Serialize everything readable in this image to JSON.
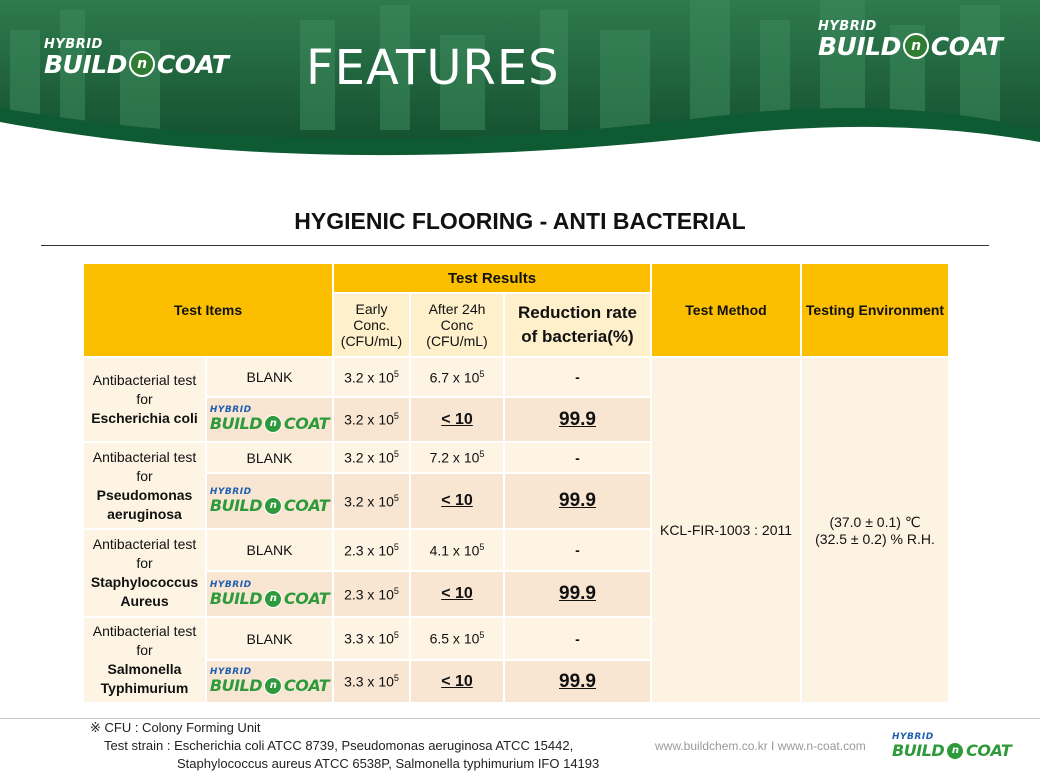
{
  "header": {
    "logo_hybrid": "HYBRID",
    "logo_build": "BUILD",
    "logo_n": "n",
    "logo_coat": "COAT",
    "title": "FEATURES"
  },
  "subtitle": "HYGIENIC FLOORING - ANTI BACTERIAL",
  "table": {
    "headers": {
      "test_items": "Test Items",
      "test_results": "Test Results",
      "early_conc": "Early Conc. (CFU/mL)",
      "after_24h": "After 24h Conc (CFU/mL)",
      "reduction": "Reduction rate of bacteria(%)",
      "test_method": "Test Method",
      "testing_env": "Testing Environment"
    },
    "test_method_value": "KCL-FIR-1003 : 2011",
    "env_line1": "(37.0 ± 0.1) ℃",
    "env_line2": "(32.5 ± 0.2) % R.H.",
    "groups": [
      {
        "prefix": "Antibacterial test for",
        "organism": "Escherichia coli",
        "blank_label": "BLANK",
        "blank_early": "3.2 x 10",
        "blank_after": "6.7 x 10",
        "blank_reduction": "-",
        "product_early": "3.2 x 10",
        "product_after": "< 10",
        "product_reduction": "99.9"
      },
      {
        "prefix": "Antibacterial test for",
        "organism": "Pseudomonas aeruginosa",
        "blank_label": "BLANK",
        "blank_early": "3.2 x 10",
        "blank_after": "7.2 x 10",
        "blank_reduction": "-",
        "product_early": "3.2 x 10",
        "product_after": "< 10",
        "product_reduction": "99.9"
      },
      {
        "prefix": "Antibacterial test for",
        "organism": "Staphylococcus Aureus",
        "blank_label": "BLANK",
        "blank_early": "2.3 x 10",
        "blank_after": "4.1 x 10",
        "blank_reduction": "-",
        "product_early": "2.3 x 10",
        "product_after": "< 10",
        "product_reduction": "99.9"
      },
      {
        "prefix": "Antibacterial test for",
        "organism": "Salmonella Typhimurium",
        "blank_label": "BLANK",
        "blank_early": "3.3 x 10",
        "blank_after": "6.5 x 10",
        "blank_reduction": "-",
        "product_early": "3.3 x 10",
        "product_after": "< 10",
        "product_reduction": "99.9"
      }
    ],
    "exponent": "5"
  },
  "footer": {
    "note1": "※ CFU : Colony Forming Unit",
    "note2": "Test strain : Escherichia coli ATCC 8739, Pseudomonas aeruginosa ATCC 15442,",
    "note3": "Staphylococcus aureus ATCC 6538P, Salmonella typhimurium IFO 14193",
    "url": "www.buildchem.co.kr I www.n-coat.com"
  },
  "colors": {
    "header_green": "#1d6b3c",
    "table_header": "#fbbf00",
    "highlight_red": "#d01010"
  }
}
